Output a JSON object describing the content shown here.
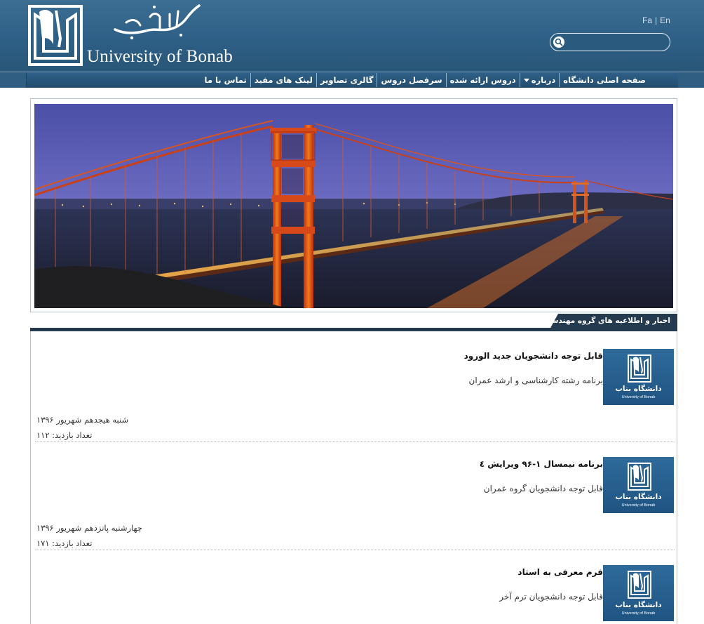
{
  "header": {
    "logo_name_fa": "دانشگاه بناب",
    "logo_name_en": "University of Bonab",
    "lang_fa": "Fa",
    "lang_separator": "|",
    "lang_en": "En",
    "search_placeholder": ""
  },
  "nav": {
    "items": [
      {
        "label": "صفحه اصلی دانشگاه"
      },
      {
        "label": "درباره",
        "has_dropdown": true
      },
      {
        "label": "دروس ارائه شده"
      },
      {
        "label": "سرفصل دروس"
      },
      {
        "label": "گالری تصاویر"
      },
      {
        "label": "لینک های مفید"
      },
      {
        "label": "تماس با ما"
      }
    ]
  },
  "news": {
    "section_title": "اخبار و اطلاعیه های گروه مهندسی عمران",
    "items": [
      {
        "title": "قابل توجه دانشجویان جدید الورود",
        "description": "برنامه رشته کارشناسی و ارشد عمران",
        "date": "شنبه هیجدهم شهریور ۱۳۹۶",
        "views": "تعداد بازدید: ۱۱۲",
        "thumb_fa": "دانشگاه بناب",
        "thumb_en": "University of Bonab"
      },
      {
        "title": "برنامه نیمسال ۱-۹۶ ویرایش ٤",
        "description": "قابل توجه دانشجویان گروه عمران",
        "date": "چهارشنبه پانزدهم شهریور ۱۳۹۶",
        "views": "تعداد بازدید: ۱۷۱",
        "thumb_fa": "دانشگاه بناب",
        "thumb_en": "University of Bonab"
      },
      {
        "title": "فرم معرفی به استاد",
        "description": "قابل توجه دانشجویان ترم آخر",
        "thumb_fa": "دانشگاه بناب",
        "thumb_en": "University of Bonab"
      }
    ]
  },
  "colors": {
    "header_blue": "#2e5f86",
    "nav_blue": "#234d6e",
    "section_dark": "#243a4f",
    "thumb_blue": "#245b89"
  }
}
